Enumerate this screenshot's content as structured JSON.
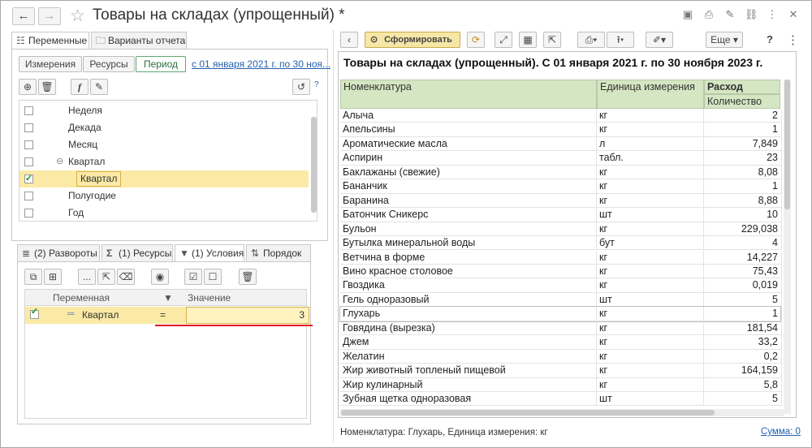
{
  "window": {
    "title": "Товары на складах (упрощенный) *"
  },
  "left": {
    "tabs": [
      {
        "label": "Переменные"
      },
      {
        "label": "Варианты отчета"
      }
    ],
    "subtabs": [
      {
        "label": "Измерения"
      },
      {
        "label": "Ресурсы"
      },
      {
        "label": "Период"
      }
    ],
    "period_link": "с 01 января 2021 г. по 30 ноя...",
    "help": "?",
    "items": [
      {
        "label": "Неделя",
        "checked": false
      },
      {
        "label": "Декада",
        "checked": false
      },
      {
        "label": "Месяц",
        "checked": false
      },
      {
        "label": "Квартал",
        "checked": false,
        "group": true
      },
      {
        "label": "Квартал",
        "checked": true,
        "selected": true
      },
      {
        "label": "Полугодие",
        "checked": false
      },
      {
        "label": "Год",
        "checked": false
      }
    ],
    "bottom_tabs": [
      {
        "label": "(2) Развороты"
      },
      {
        "label": "(1) Ресурсы"
      },
      {
        "label": "(1) Условия"
      },
      {
        "label": "Порядок"
      }
    ],
    "dots_label": "...",
    "conditions": {
      "headers": {
        "variable": "Переменная",
        "value": "Значение"
      },
      "rows": [
        {
          "variable": "Квартал",
          "op": "=",
          "value": "3"
        }
      ]
    }
  },
  "right": {
    "toolbar": {
      "generate": "Сформировать",
      "more": "Еще",
      "help": "?"
    },
    "report_title": "Товары на складах (упрощенный). С 01 января 2021 г. по 30 ноября 2023 г.",
    "headers": {
      "nomenclature": "Номенклатура",
      "unit": "Единица измерения",
      "expense": "Расход",
      "quantity": "Количество"
    },
    "rows": [
      {
        "name": "Алыча",
        "unit": "кг",
        "qty": "2"
      },
      {
        "name": "Апельсины",
        "unit": "кг",
        "qty": "1"
      },
      {
        "name": "Ароматические масла",
        "unit": "л",
        "qty": "7,849"
      },
      {
        "name": "Аспирин",
        "unit": "табл.",
        "qty": "23"
      },
      {
        "name": "Баклажаны (свежие)",
        "unit": "кг",
        "qty": "8,08"
      },
      {
        "name": "Бананчик",
        "unit": "кг",
        "qty": "1"
      },
      {
        "name": "Баранина",
        "unit": "кг",
        "qty": "8,88"
      },
      {
        "name": "Батончик Сникерс",
        "unit": "шт",
        "qty": "10"
      },
      {
        "name": "Бульон",
        "unit": "кг",
        "qty": "229,038"
      },
      {
        "name": "Бутылка минеральной воды",
        "unit": "бут",
        "qty": "4"
      },
      {
        "name": "Ветчина в форме",
        "unit": "кг",
        "qty": "14,227"
      },
      {
        "name": "Вино красное столовое",
        "unit": "кг",
        "qty": "75,43"
      },
      {
        "name": "Гвоздика",
        "unit": "кг",
        "qty": "0,019"
      },
      {
        "name": "Гель одноразовый",
        "unit": "шт",
        "qty": "5"
      },
      {
        "name": "Глухарь",
        "unit": "кг",
        "qty": "1"
      },
      {
        "name": "Говядина (вырезка)",
        "unit": "кг",
        "qty": "181,54"
      },
      {
        "name": "Джем",
        "unit": "кг",
        "qty": "33,2"
      },
      {
        "name": "Желатин",
        "unit": "кг",
        "qty": "0,2"
      },
      {
        "name": "Жир животный топленый пищевой",
        "unit": "кг",
        "qty": "164,159"
      },
      {
        "name": "Жир кулинарный",
        "unit": "кг",
        "qty": "5,8"
      },
      {
        "name": "Зубная щетка одноразовая",
        "unit": "шт",
        "qty": "5"
      }
    ],
    "status": "Номенклатура: Глухарь, Единица измерения: кг",
    "sum_link": "Сумма: 0"
  }
}
